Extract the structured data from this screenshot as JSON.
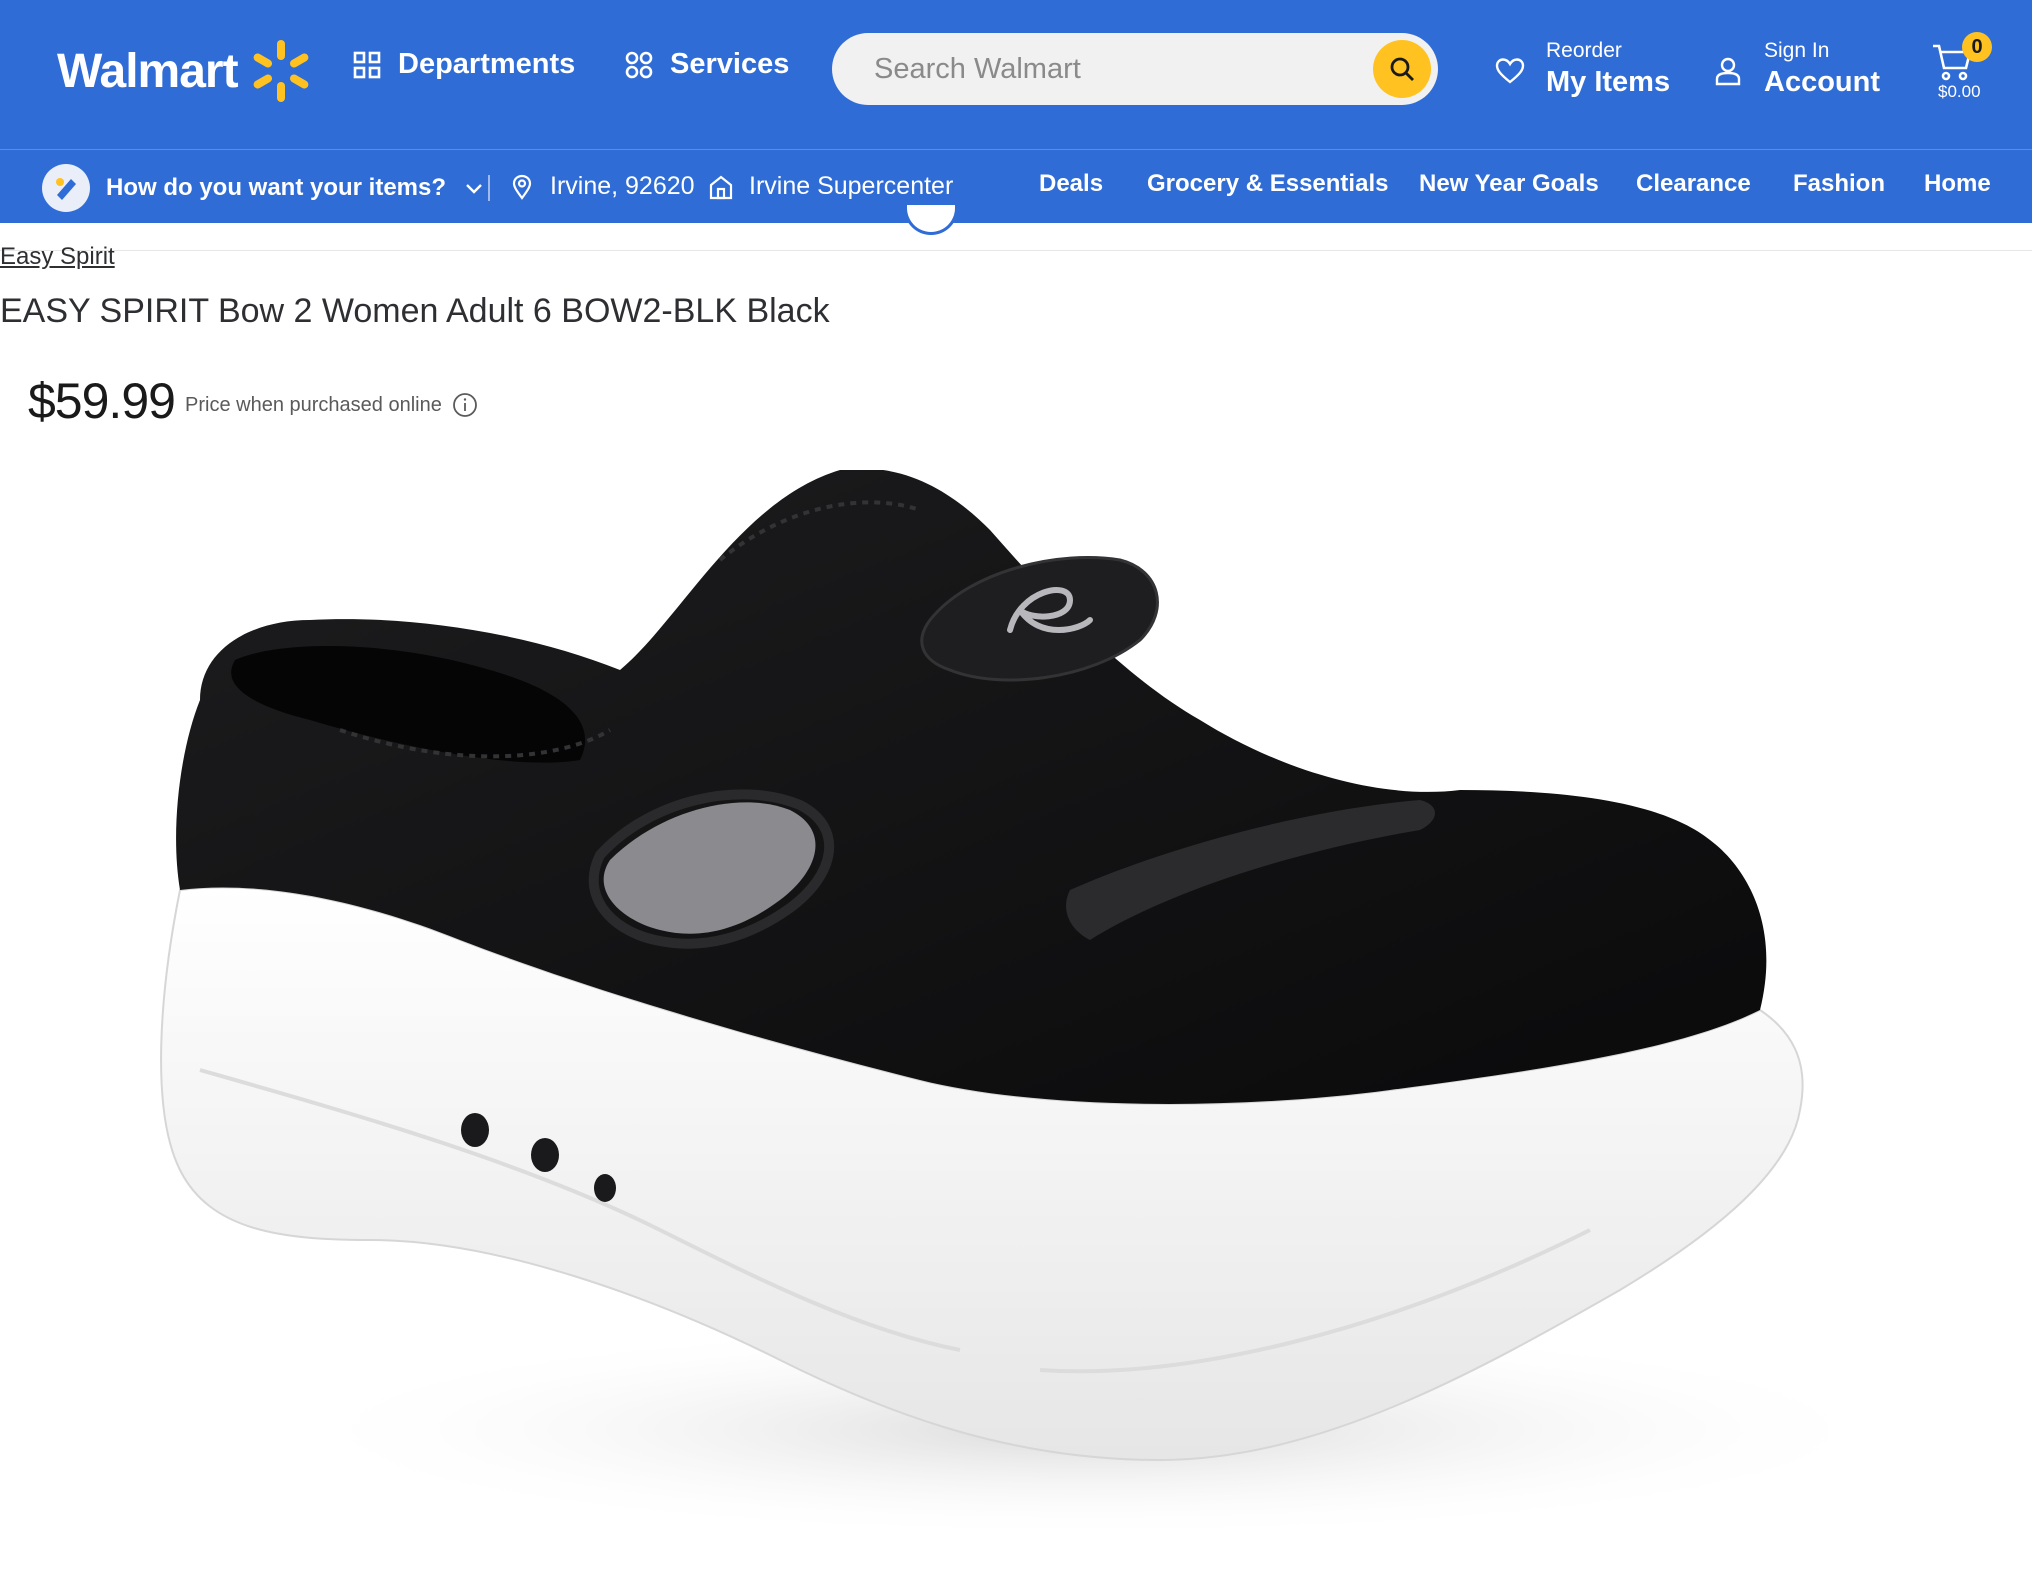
{
  "header": {
    "logo_text": "Walmart",
    "departments_label": "Departments",
    "services_label": "Services",
    "search": {
      "placeholder": "Search Walmart",
      "value": ""
    },
    "reorder": {
      "small": "Reorder",
      "big": "My Items"
    },
    "account": {
      "small": "Sign In",
      "big": "Account"
    },
    "cart": {
      "count": "0",
      "total": "$0.00"
    }
  },
  "subbar": {
    "fulfillment_prompt": "How do you want your items?",
    "zip_location": "Irvine, 92620",
    "store": "Irvine Supercenter",
    "categories": [
      "Deals",
      "Grocery & Essentials",
      "New Year Goals",
      "Clearance",
      "Fashion",
      "Home"
    ]
  },
  "product": {
    "brand": "Easy Spirit",
    "title": "EASY SPIRIT Bow 2 Women Adult 6 BOW2-BLK Black",
    "price": "$59.99",
    "price_note": "Price when purchased online",
    "image_alt": "black slip-on mule sneaker with white sole"
  },
  "colors": {
    "header_blue": "#2f6cd6",
    "spark_yellow": "#ffc220",
    "search_bg": "#f1f1f2"
  },
  "icons": [
    "departments-grid-icon",
    "services-icon",
    "search-icon",
    "heart-icon",
    "person-icon",
    "cart-icon",
    "fulfillment-icon",
    "chevron-down-icon",
    "location-pin-icon",
    "store-icon",
    "info-icon"
  ]
}
